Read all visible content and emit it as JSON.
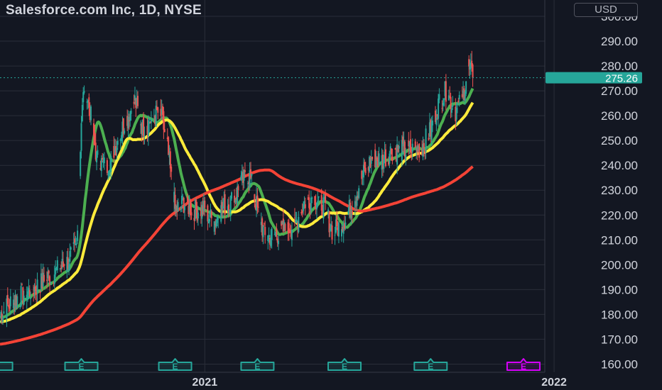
{
  "header": {
    "title": "Salesforce.com Inc, 1D, NYSE",
    "currency": "USD"
  },
  "colors": {
    "background": "#131722",
    "grid": "#2a2e39",
    "up": "#26a69a",
    "down": "#ef5350",
    "ma_fast": "#4caf50",
    "ma_mid": "#ffeb3b",
    "ma_slow": "#f44336",
    "price_tag": "#26a69a",
    "earnings_past": "#26a69a",
    "earnings_future": "#d500f9"
  },
  "chart_data": {
    "type": "candlestick",
    "title": "Salesforce.com Inc, 1D, NYSE",
    "currency": "USD",
    "x_range": [
      "2020-06-01",
      "2022-03-31"
    ],
    "x_tick_labels": [
      {
        "date": "2021-01-01",
        "label": "2021"
      },
      {
        "date": "2022-01-01",
        "label": "2022"
      }
    ],
    "ylim": [
      151,
      300
    ],
    "y_ticks": [
      160,
      170,
      180,
      190,
      200,
      210,
      220,
      230,
      240,
      250,
      260,
      270,
      280,
      290,
      300
    ],
    "y_tick_labels": [
      "160.00",
      "170.00",
      "180.00",
      "190.00",
      "200.00",
      "210.00",
      "220.00",
      "230.00",
      "240.00",
      "250.00",
      "260.00",
      "270.00",
      "280.00",
      "290.00",
      "300.00"
    ],
    "last_price": 275.26,
    "last_price_label": "275.26",
    "price_anchors": [
      [
        "2020-06-01",
        180
      ],
      [
        "2020-06-15",
        186
      ],
      [
        "2020-07-01",
        189
      ],
      [
        "2020-07-15",
        193
      ],
      [
        "2020-08-01",
        198
      ],
      [
        "2020-08-10",
        201
      ],
      [
        "2020-08-20",
        208
      ],
      [
        "2020-08-25",
        258
      ],
      [
        "2020-08-28",
        272
      ],
      [
        "2020-09-03",
        262
      ],
      [
        "2020-09-10",
        243
      ],
      [
        "2020-09-20",
        239
      ],
      [
        "2020-10-01",
        249
      ],
      [
        "2020-10-10",
        258
      ],
      [
        "2020-10-20",
        266
      ],
      [
        "2020-10-28",
        255
      ],
      [
        "2020-11-05",
        258
      ],
      [
        "2020-11-15",
        262
      ],
      [
        "2020-11-22",
        250
      ],
      [
        "2020-12-01",
        222
      ],
      [
        "2020-12-10",
        225
      ],
      [
        "2020-12-20",
        222
      ],
      [
        "2021-01-01",
        222
      ],
      [
        "2021-01-10",
        217
      ],
      [
        "2021-01-20",
        223
      ],
      [
        "2021-02-01",
        227
      ],
      [
        "2021-02-10",
        234
      ],
      [
        "2021-02-17",
        236
      ],
      [
        "2021-02-25",
        222
      ],
      [
        "2021-03-05",
        211
      ],
      [
        "2021-03-15",
        212
      ],
      [
        "2021-03-25",
        214
      ],
      [
        "2021-04-05",
        216
      ],
      [
        "2021-04-15",
        225
      ],
      [
        "2021-04-25",
        228
      ],
      [
        "2021-05-05",
        224
      ],
      [
        "2021-05-15",
        213
      ],
      [
        "2021-05-25",
        217
      ],
      [
        "2021-06-05",
        225
      ],
      [
        "2021-06-15",
        236
      ],
      [
        "2021-06-25",
        243
      ],
      [
        "2021-07-05",
        242
      ],
      [
        "2021-07-15",
        246
      ],
      [
        "2021-07-25",
        246
      ],
      [
        "2021-08-05",
        246
      ],
      [
        "2021-08-15",
        247
      ],
      [
        "2021-08-25",
        254
      ],
      [
        "2021-09-01",
        264
      ],
      [
        "2021-09-10",
        270
      ],
      [
        "2021-09-20",
        262
      ],
      [
        "2021-09-27",
        266
      ],
      [
        "2021-10-03",
        280
      ],
      [
        "2021-10-08",
        275.26
      ]
    ],
    "indicators": [
      {
        "kind": "moving_average",
        "color": "#4caf50",
        "period": 20
      },
      {
        "kind": "moving_average",
        "color": "#ffeb3b",
        "period": 50
      },
      {
        "kind": "moving_average",
        "color": "#f44336",
        "period": 200
      }
    ],
    "earnings_markers": [
      {
        "date": "2020-05-28",
        "label": "E",
        "status": "reported"
      },
      {
        "date": "2020-08-25",
        "label": "E",
        "status": "reported"
      },
      {
        "date": "2020-12-01",
        "label": "E",
        "status": "reported"
      },
      {
        "date": "2021-02-25",
        "label": "E",
        "status": "reported"
      },
      {
        "date": "2021-05-27",
        "label": "E",
        "status": "reported"
      },
      {
        "date": "2021-08-25",
        "label": "E",
        "status": "reported"
      },
      {
        "date": "2021-11-30",
        "label": "E",
        "status": "upcoming"
      }
    ],
    "grid": true
  }
}
